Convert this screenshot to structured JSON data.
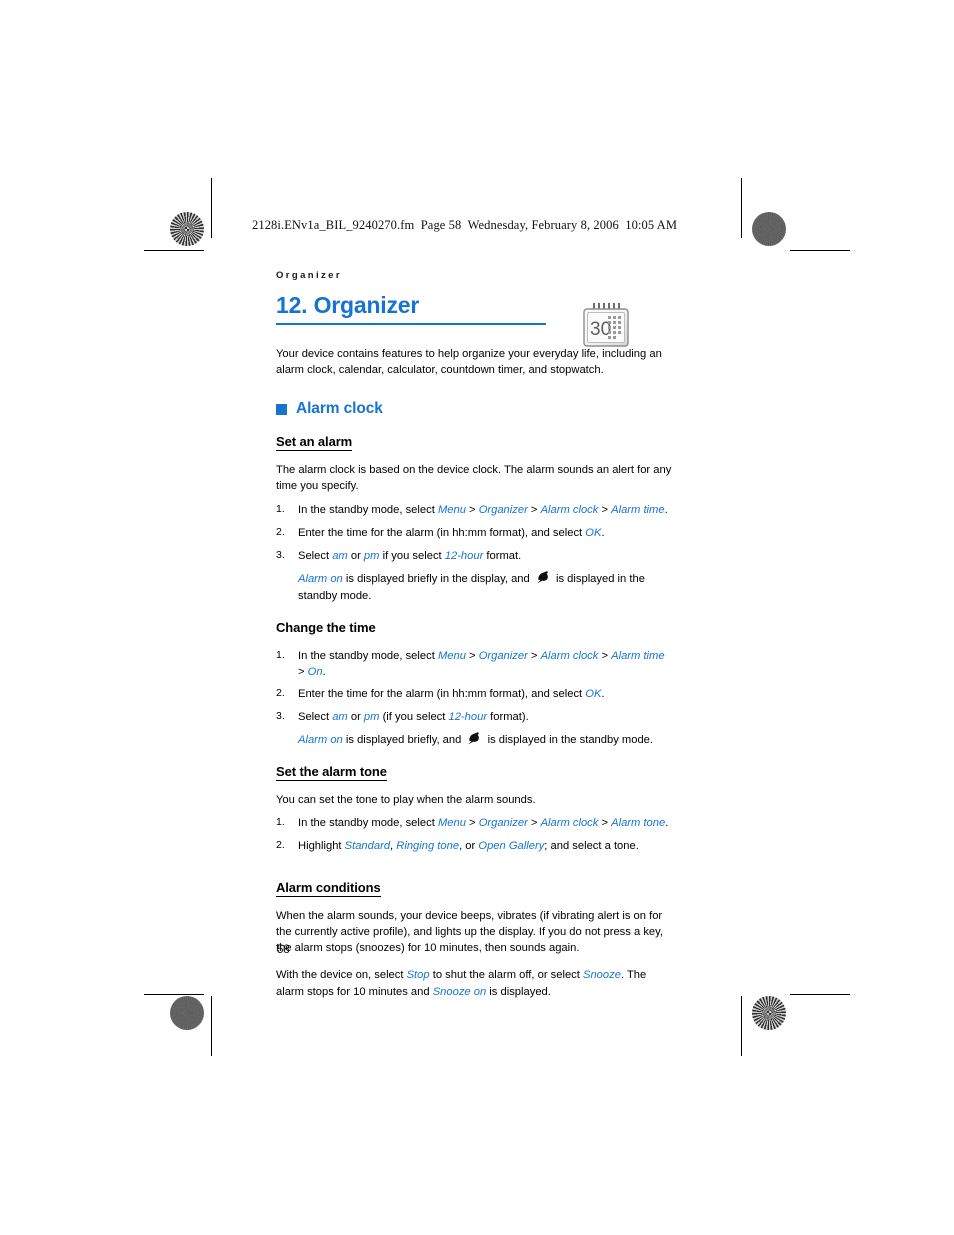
{
  "document": {
    "fm_header": "2128i.ENv1a_BIL_9240270.fm  Page 58  Wednesday, February 8, 2006  10:05 AM",
    "running_head": "Organizer",
    "page_number": "58",
    "accent_color": "#1673d1",
    "text_color": "#000000"
  },
  "chapter": {
    "title": "12. Organizer",
    "icon": "calendar-icon",
    "icon_day": "30",
    "intro": "Your device contains features to help organize your everyday life, including an alarm clock, calendar, calculator, countdown timer, and stopwatch."
  },
  "section": {
    "bullet_label": "Alarm clock"
  },
  "set_an_alarm": {
    "heading": "Set an alarm",
    "intro": "The alarm clock is based on the device clock. The alarm sounds an alert for any time you specify.",
    "steps": [
      {
        "num": "1.",
        "parts": [
          {
            "t": "In the standby mode, select ",
            "s": "plain"
          },
          {
            "t": "Menu",
            "s": "link"
          },
          {
            "t": " > ",
            "s": "plain"
          },
          {
            "t": "Organizer",
            "s": "link"
          },
          {
            "t": " > ",
            "s": "plain"
          },
          {
            "t": "Alarm clock",
            "s": "link"
          },
          {
            "t": " > ",
            "s": "plain"
          },
          {
            "t": "Alarm time",
            "s": "link"
          },
          {
            "t": ".",
            "s": "plain"
          }
        ]
      },
      {
        "num": "2.",
        "parts": [
          {
            "t": "Enter the time for the alarm (in hh:mm format), and select ",
            "s": "plain"
          },
          {
            "t": "OK",
            "s": "link"
          },
          {
            "t": ".",
            "s": "plain"
          }
        ]
      },
      {
        "num": "3.",
        "parts": [
          {
            "t": "Select ",
            "s": "plain"
          },
          {
            "t": "am",
            "s": "link"
          },
          {
            "t": " or ",
            "s": "plain"
          },
          {
            "t": "pm",
            "s": "link"
          },
          {
            "t": " if you select ",
            "s": "plain"
          },
          {
            "t": "12-hour",
            "s": "link"
          },
          {
            "t": " format.",
            "s": "plain"
          }
        ]
      }
    ],
    "note_parts": [
      {
        "t": "Alarm on",
        "s": "link"
      },
      {
        "t": " is displayed briefly in the display, and ",
        "s": "plain"
      },
      {
        "t": "",
        "s": "bell-icon"
      },
      {
        "t": " is displayed in the standby mode.",
        "s": "plain"
      }
    ]
  },
  "change_the_time": {
    "heading": "Change the time",
    "steps": [
      {
        "num": "1.",
        "parts": [
          {
            "t": "In the standby mode, select ",
            "s": "plain"
          },
          {
            "t": "Menu",
            "s": "link"
          },
          {
            "t": " > ",
            "s": "plain"
          },
          {
            "t": "Organizer",
            "s": "link"
          },
          {
            "t": " > ",
            "s": "plain"
          },
          {
            "t": "Alarm clock",
            "s": "link"
          },
          {
            "t": " > ",
            "s": "plain"
          },
          {
            "t": "Alarm time",
            "s": "link"
          },
          {
            "t": " > ",
            "s": "plain"
          },
          {
            "t": "On",
            "s": "link"
          },
          {
            "t": ".",
            "s": "plain"
          }
        ]
      },
      {
        "num": "2.",
        "parts": [
          {
            "t": "Enter the time for the alarm (in hh:mm format), and select ",
            "s": "plain"
          },
          {
            "t": "OK",
            "s": "link"
          },
          {
            "t": ".",
            "s": "plain"
          }
        ]
      },
      {
        "num": "3.",
        "parts": [
          {
            "t": "Select ",
            "s": "plain"
          },
          {
            "t": "am",
            "s": "link"
          },
          {
            "t": " or ",
            "s": "plain"
          },
          {
            "t": "pm",
            "s": "link"
          },
          {
            "t": " (if you select ",
            "s": "plain"
          },
          {
            "t": "12-hour",
            "s": "link"
          },
          {
            "t": " format).",
            "s": "plain"
          }
        ]
      }
    ],
    "note_parts": [
      {
        "t": "Alarm on",
        "s": "link"
      },
      {
        "t": " is displayed briefly, and ",
        "s": "plain"
      },
      {
        "t": "",
        "s": "bell-icon"
      },
      {
        "t": " is displayed in the standby mode.",
        "s": "plain"
      }
    ]
  },
  "set_the_alarm_tone": {
    "heading": "Set the alarm tone",
    "intro": "You can set the tone to play when the alarm sounds.",
    "steps": [
      {
        "num": "1.",
        "parts": [
          {
            "t": "In the standby mode, select ",
            "s": "plain"
          },
          {
            "t": "Menu",
            "s": "link"
          },
          {
            "t": " > ",
            "s": "plain"
          },
          {
            "t": "Organizer",
            "s": "link"
          },
          {
            "t": " > ",
            "s": "plain"
          },
          {
            "t": "Alarm clock",
            "s": "link"
          },
          {
            "t": " > ",
            "s": "plain"
          },
          {
            "t": "Alarm tone",
            "s": "link"
          },
          {
            "t": ".",
            "s": "plain"
          }
        ]
      },
      {
        "num": "2.",
        "parts": [
          {
            "t": "Highlight ",
            "s": "plain"
          },
          {
            "t": "Standard",
            "s": "link"
          },
          {
            "t": ", ",
            "s": "plain"
          },
          {
            "t": "Ringing tone",
            "s": "link"
          },
          {
            "t": ", or ",
            "s": "plain"
          },
          {
            "t": "Open Gallery",
            "s": "link"
          },
          {
            "t": "; and select a tone.",
            "s": "plain"
          }
        ]
      }
    ]
  },
  "alarm_conditions": {
    "heading": "Alarm conditions",
    "para1": "When the alarm sounds, your device beeps, vibrates (if vibrating alert is on for the currently active profile), and lights up the display. If you do not press a key, the alarm stops (snoozes) for 10 minutes, then sounds again.",
    "para2_parts": [
      {
        "t": "With the device on, select ",
        "s": "plain"
      },
      {
        "t": "Stop",
        "s": "link"
      },
      {
        "t": " to shut the alarm off, or select ",
        "s": "plain"
      },
      {
        "t": "Snooze",
        "s": "link"
      },
      {
        "t": ". The alarm stops for 10 minutes and ",
        "s": "plain"
      },
      {
        "t": "Snooze on",
        "s": "link"
      },
      {
        "t": " is displayed.",
        "s": "plain"
      }
    ]
  }
}
